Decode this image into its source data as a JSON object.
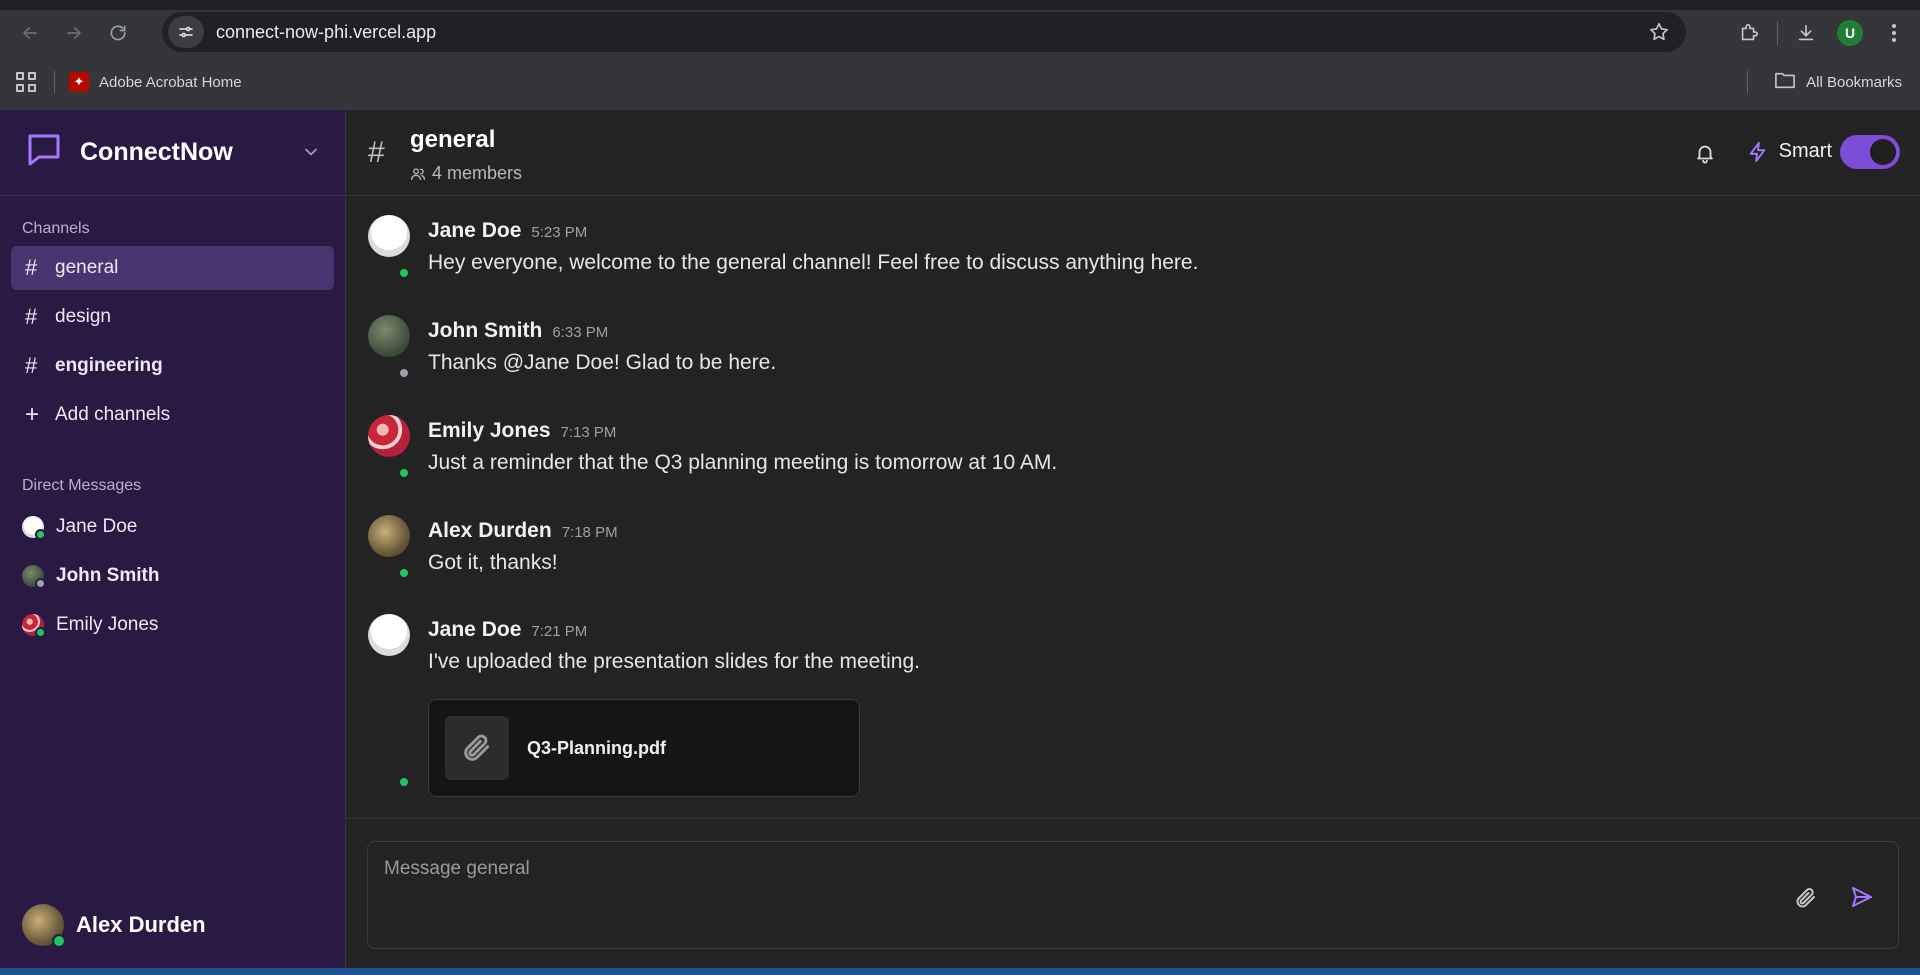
{
  "browser": {
    "url": "connect-now-phi.vercel.app",
    "bookmark_acrobat": "Adobe Acrobat Home",
    "all_bookmarks": "All Bookmarks",
    "profile_initial": "U"
  },
  "sidebar": {
    "brand": "ConnectNow",
    "channels_label": "Channels",
    "channels": [
      {
        "name": "general",
        "active": true
      },
      {
        "name": "design"
      },
      {
        "name": "engineering",
        "unread": true
      }
    ],
    "add_channels": "Add channels",
    "dm_label": "Direct Messages",
    "dms": [
      {
        "name": "Jane Doe",
        "status": "online"
      },
      {
        "name": "John Smith",
        "status": "offline",
        "unread": true
      },
      {
        "name": "Emily Jones",
        "status": "online"
      }
    ],
    "current_user": "Alex Durden"
  },
  "channel": {
    "name": "general",
    "members": "4 members",
    "smart_label": "Smart",
    "smart_enabled": true
  },
  "messages": [
    {
      "author": "Jane Doe",
      "time": "5:23 PM",
      "text": "Hey everyone, welcome to the general channel! Feel free to discuss anything here.",
      "status": "online"
    },
    {
      "author": "John Smith",
      "time": "6:33 PM",
      "text": "Thanks @Jane Doe! Glad to be here.",
      "status": "offline"
    },
    {
      "author": "Emily Jones",
      "time": "7:13 PM",
      "text": "Just a reminder that the Q3 planning meeting is tomorrow at 10 AM.",
      "status": "online"
    },
    {
      "author": "Alex Durden",
      "time": "7:18 PM",
      "text": "Got it, thanks!",
      "status": "online"
    },
    {
      "author": "Jane Doe",
      "time": "7:21 PM",
      "text": "I've uploaded the presentation slides for the meeting.",
      "status": "online",
      "attachment": "Q3-Planning.pdf"
    }
  ],
  "composer": {
    "placeholder": "Message general"
  },
  "colors": {
    "sidebar_bg": "#2a1a43",
    "accent": "#a778ff",
    "online": "#22c55e",
    "offline": "#9ca3af"
  }
}
